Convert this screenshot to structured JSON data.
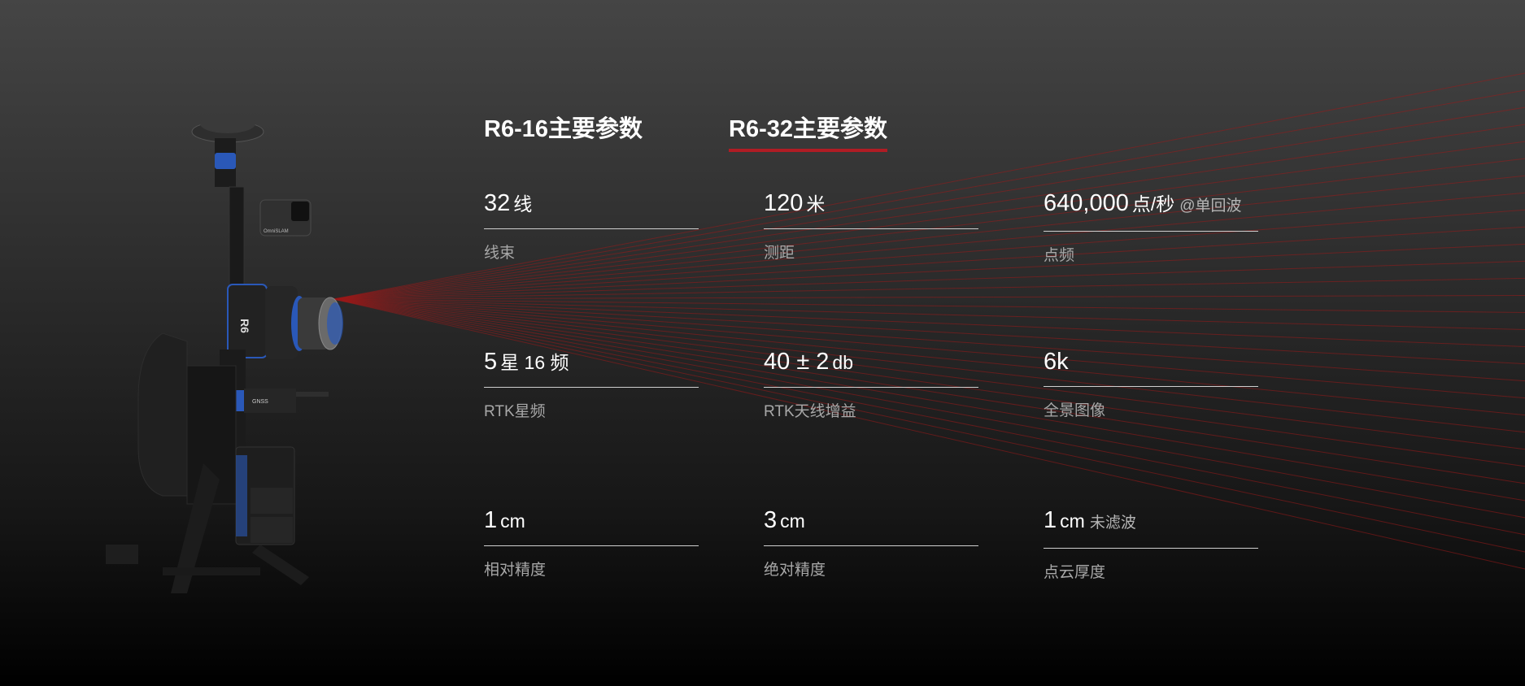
{
  "colors": {
    "accent": "#b01c24",
    "device_blue": "#2a58b8",
    "ray": "#9c1a1a"
  },
  "device": {
    "brand": "OmniSLAM",
    "model": "R6",
    "gnss_label": "GNSS"
  },
  "tabs": [
    {
      "label": "R6-16主要参数",
      "active": false
    },
    {
      "label": "R6-32主要参数",
      "active": true
    }
  ],
  "specs": [
    {
      "value": "32",
      "unit": "线",
      "note": "",
      "label": "线束"
    },
    {
      "value": "120",
      "unit": "米",
      "note": "",
      "label": "测距"
    },
    {
      "value": "640,000",
      "unit": "点/秒",
      "note": "@单回波",
      "label": "点频"
    },
    {
      "value": "5",
      "unit": "星 16 频",
      "note": "",
      "label": "RTK星频"
    },
    {
      "value": "40 ± 2",
      "unit": "db",
      "note": "",
      "label": "RTK天线增益"
    },
    {
      "value": "6k",
      "unit": "",
      "note": "",
      "label": "全景图像"
    },
    {
      "value": "1",
      "unit": "cm",
      "note": "",
      "label": "相对精度"
    },
    {
      "value": "3",
      "unit": "cm",
      "note": "",
      "label": "绝对精度"
    },
    {
      "value": "1",
      "unit": "cm",
      "note": "未滤波",
      "label": "点云厚度"
    }
  ]
}
